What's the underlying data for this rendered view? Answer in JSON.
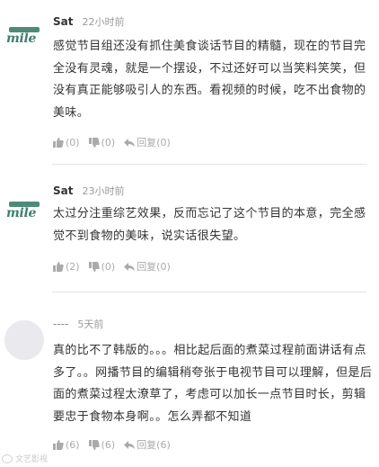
{
  "comments": [
    {
      "username": "Sat",
      "time": "22小时前",
      "avatar_text": "mile",
      "text": "感觉节目组还没有抓住美食谈话节目的精髓，现在的节目完全没有灵魂，就是一个摆设，不过还好可以当笑料笑笑，但没有真正能够吸引人的东西。看视频的时候，吃不出食物的美味。",
      "like_count": "(0)",
      "dislike_count": "(0)",
      "reply_label": "回复(0)"
    },
    {
      "username": "Sat",
      "time": "23小时前",
      "avatar_text": "mile",
      "text": "太过分注重综艺效果，反而忘记了这个节目的本意，完全感觉不到食物的美味，说实话很失望。",
      "like_count": "(2)",
      "dislike_count": "(0)",
      "reply_label": "回复(0)"
    },
    {
      "username": "----",
      "time": "5天前",
      "text": "真的比不了韩版的。。。相比起后面的煮菜过程前面讲话有点多了。。网播节目的编辑稍夸张于电视节目可以理解，但是后面的煮菜过程太潦草了，考虑可以加长一点节目时长，剪辑要忠于食物本身啊。。怎么弄都不知道",
      "like_count": "(6)",
      "dislike_count": "(6)",
      "reply_label": "回复(6)"
    }
  ],
  "watermark": "文艺影视",
  "colors": {
    "text": "#333333",
    "meta": "#9b9b9b",
    "action": "#aaaaaa",
    "avatar_green": "#3f7f70",
    "divider": "#e4e4e4"
  },
  "icons": [
    "thumbs-up-icon",
    "thumbs-down-icon",
    "reply-icon"
  ]
}
